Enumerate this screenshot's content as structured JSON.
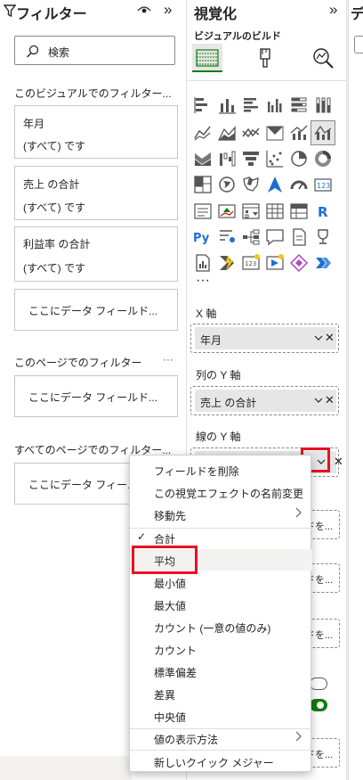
{
  "filter_pane": {
    "title": "フィルター",
    "search_placeholder": "検索",
    "visual_section": "このビジュアルでのフィルター...",
    "page_section": "このページでのフィルター",
    "all_pages_section": "すべてのページでのフィルター...",
    "more": "···",
    "cards": [
      {
        "name": "年月",
        "value": "(すべて) です"
      },
      {
        "name": "売上 の合計",
        "value": "(すべて) です"
      },
      {
        "name": "利益率 の合計",
        "value": "(すべて) です"
      }
    ],
    "drop_text": "ここにデータ フィールド...",
    "drop_text_partial": "ここにデータ フィー..."
  },
  "viz_pane": {
    "title": "視覚化",
    "subtitle": "ビジュアルのビルド",
    "more": "···",
    "x_axis_label": "X 軸",
    "x_axis_field": "年月",
    "col_y_label": "列の Y 軸",
    "col_y_field": "売上 の合計",
    "line_y_label": "線の Y 軸",
    "partial_well_text": "ドを..."
  },
  "right_strip": {
    "title": "デ"
  },
  "context_menu": {
    "items": [
      {
        "label": "フィールドを削除",
        "check": false,
        "submenu": false
      },
      {
        "label": "この視覚エフェクトの名前変更",
        "check": false,
        "submenu": false
      },
      {
        "label": "移動先",
        "check": false,
        "submenu": true
      },
      {
        "label": "合計",
        "check": true,
        "submenu": false
      },
      {
        "label": "平均",
        "check": false,
        "submenu": false
      },
      {
        "label": "最小値",
        "check": false,
        "submenu": false
      },
      {
        "label": "最大値",
        "check": false,
        "submenu": false
      },
      {
        "label": "カウント (一意の値のみ)",
        "check": false,
        "submenu": false
      },
      {
        "label": "カウント",
        "check": false,
        "submenu": false
      },
      {
        "label": "標準偏差",
        "check": false,
        "submenu": false
      },
      {
        "label": "差異",
        "check": false,
        "submenu": false
      },
      {
        "label": "中央値",
        "check": false,
        "submenu": false
      },
      {
        "label": "値の表示方法",
        "check": false,
        "submenu": true
      },
      {
        "label": "新しいクイック メジャー",
        "check": false,
        "submenu": false
      }
    ],
    "check_glyph": "✓"
  },
  "colors": {
    "highlight_red": "#e81123",
    "accent_green": "#107c10"
  }
}
